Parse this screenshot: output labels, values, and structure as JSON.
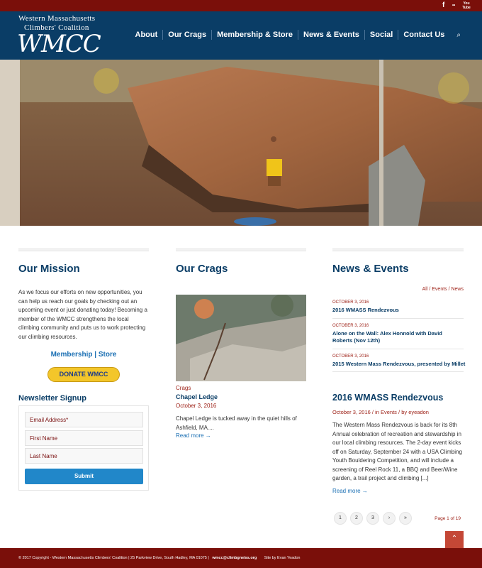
{
  "social": {
    "facebook": "f",
    "flickr": "••",
    "youtube": "You Tube"
  },
  "logo": {
    "line1": "Western Massachusetts",
    "line2": "Climbers' Coalition",
    "mark": "WMCC"
  },
  "nav": {
    "items": [
      "About",
      "Our Crags",
      "Membership & Store",
      "News & Events",
      "Social",
      "Contact Us"
    ],
    "search_icon": "⌕"
  },
  "mission": {
    "title": "Our Mission",
    "text": "As we focus our efforts on new opportunities, you can help us reach our goals by checking out an upcoming event or just donating today! Becoming a member of the WMCC strengthens the local climbing community and puts us to work protecting our climbing resources.",
    "membership_link": "Membership",
    "separator": "|",
    "store_link": "Store",
    "donate_label": "DONATE WMCC"
  },
  "newsletter": {
    "title": "Newsletter Signup",
    "email_placeholder": "Email Address*",
    "first_placeholder": "First Name",
    "last_placeholder": "Last Name",
    "submit_label": "Submit"
  },
  "crags": {
    "title": "Our Crags",
    "category": "Crags",
    "post_title": "Chapel Ledge",
    "date": "October 3, 2016",
    "excerpt": "Chapel Ledge is tucked away in the quiet hills of Ashfield, MA....",
    "read_more": "Read more →"
  },
  "news": {
    "title": "News & Events",
    "filter": "All / Events / News",
    "items": [
      {
        "date": "OCTOBER 3, 2016",
        "title": "2016 WMASS Rendezvous"
      },
      {
        "date": "OCTOBER 3, 2016",
        "title": "Alone on the Wall: Alex Honnold with David Roberts (Nov 12th)"
      },
      {
        "date": "OCTOBER 3, 2016",
        "title": "2015 Western Mass Rendezvous, presented by Millet"
      }
    ],
    "featured_title": "2016 WMASS Rendezvous",
    "featured_meta_date": "October 3, 2016",
    "featured_meta_cat": "in Events",
    "featured_meta_author": "by eyeadon",
    "featured_excerpt": "The Western Mass Rendezvous is back for its 8th Annual celebration of recreation and stewardship in our local climbing resources. The 2-day event kicks off on Saturday, September 24 with a USA Climbing Youth Bouldering Competition, and will include a screening of Reel Rock 11, a BBQ and Beer/Wine garden, a trail project and climbing [...]",
    "read_more": "Read more →",
    "pages": [
      "1",
      "2",
      "3",
      "›",
      "»"
    ],
    "page_of": "Page 1 of 19"
  },
  "footer": {
    "copyright": "© 2017 Copyright - Western Massachusetts Climbers' Coalition | 25 Parkview Drive, South Hadley, MA 01075 |",
    "email": "wmcc@climbgneiss.org",
    "credit": "Site by Evan Yeadon"
  },
  "totop_icon": "⌃"
}
